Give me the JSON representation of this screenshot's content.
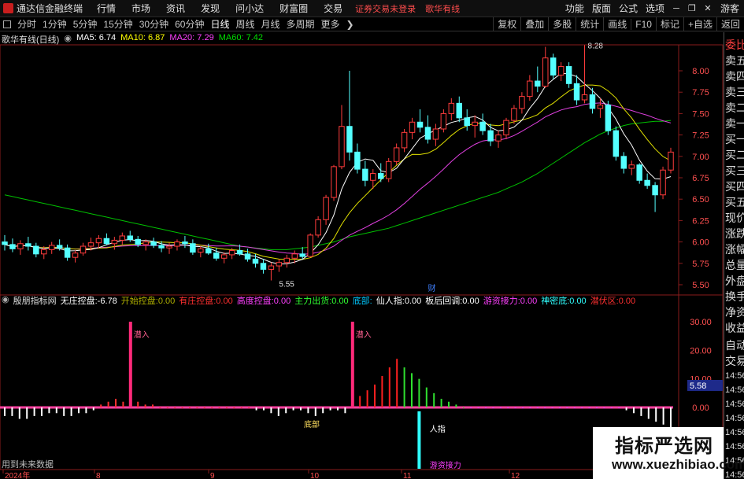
{
  "menubar": {
    "app_title": "通达信金融终端",
    "menus": [
      "行情",
      "市场",
      "资讯",
      "发现",
      "问小达",
      "财富圈",
      "交易"
    ],
    "notice": "证券交易未登录",
    "stock_name": "歌华有线",
    "right_menus": [
      "功能",
      "版面",
      "公式",
      "选项"
    ],
    "guest": "游客"
  },
  "toolbar": {
    "periods": [
      "分时",
      "1分钟",
      "5分钟",
      "15分钟",
      "30分钟",
      "60分钟",
      "日线",
      "周线",
      "月线",
      "多周期",
      "更多"
    ],
    "active": "日线",
    "right_tools": [
      "复权",
      "叠加",
      "多股",
      "统计",
      "画线",
      "F10",
      "标记",
      "+自选",
      "返回"
    ]
  },
  "main_chart": {
    "title": "歌华有线(日线)",
    "ma_values": [
      {
        "label": "MA5",
        "value": "6.74",
        "color": "#ffffff"
      },
      {
        "label": "MA10",
        "value": "6.87",
        "color": "#ffff00"
      },
      {
        "label": "MA20",
        "value": "7.29",
        "color": "#ff40ff"
      },
      {
        "label": "MA60",
        "value": "7.42",
        "color": "#00e000"
      }
    ],
    "price_axis": [
      "8.00",
      "7.75",
      "7.50",
      "7.25",
      "7.00",
      "6.75",
      "6.50",
      "6.25",
      "6.00",
      "5.75",
      "5.50"
    ],
    "high_label": "8.28",
    "low_label": "5.55",
    "event_label": "财"
  },
  "indicator": {
    "name": "殷朋指标网",
    "fields": [
      {
        "label": "无庄控盘:",
        "value": "-6.78",
        "color": "#ffffff"
      },
      {
        "label": "开始控盘:",
        "value": "0.00",
        "color": "#b0b000"
      },
      {
        "label": "有庄控盘:",
        "value": "0.00",
        "color": "#ff3030"
      },
      {
        "label": "高度控盘:",
        "value": "0.00",
        "color": "#ff40ff"
      },
      {
        "label": "主力出货:",
        "value": "0.00",
        "color": "#30ff30"
      },
      {
        "label": "底部:",
        "value": "",
        "color": "#00c8ff"
      },
      {
        "label": "仙人指:",
        "value": "0.00",
        "color": "#ffffff"
      },
      {
        "label": "板后回调:",
        "value": "0.00",
        "color": "#ffffff"
      },
      {
        "label": "游资接力:",
        "value": "0.00",
        "color": "#ff40ff"
      },
      {
        "label": "神密底:",
        "value": "0.00",
        "color": "#30ffff"
      },
      {
        "label": "潜伏区:",
        "value": "0.00",
        "color": "#ff3030"
      }
    ],
    "axis": [
      "30.00",
      "20.00",
      "10.00",
      "0.00"
    ],
    "current_value": "5.58",
    "annotations": {
      "qianru": "潜入",
      "dibu": "底部",
      "renzhi": "人指",
      "youzi": "游资接力"
    }
  },
  "date_axis": [
    "2024年",
    "8",
    "9",
    "10",
    "11",
    "12"
  ],
  "side_panel": {
    "items": [
      "委比",
      "卖五",
      "卖四",
      "卖三",
      "卖二",
      "卖一",
      "买一",
      "买二",
      "买三",
      "买四",
      "买五",
      "现价",
      "涨跌",
      "涨幅",
      "总量",
      "外盘",
      "换手",
      "净资",
      "收益",
      "自动",
      "交易"
    ],
    "times": [
      "14:56",
      "14:56",
      "14:56",
      "14:56",
      "14:56",
      "14:56",
      "14:56",
      "14:56"
    ]
  },
  "footnote": "用到未来数据",
  "watermark": {
    "title": "指标严选网",
    "url": "www.xuezhibiao.com"
  },
  "chart_data": {
    "type": "candlestick",
    "candles": [
      [
        6.0,
        6.08,
        5.9,
        5.97
      ],
      [
        5.97,
        6.04,
        5.88,
        5.92
      ],
      [
        5.92,
        6.02,
        5.85,
        5.98
      ],
      [
        5.98,
        6.06,
        5.9,
        5.95
      ],
      [
        5.95,
        5.99,
        5.82,
        5.86
      ],
      [
        5.86,
        5.95,
        5.8,
        5.91
      ],
      [
        5.91,
        6.0,
        5.86,
        5.96
      ],
      [
        5.96,
        6.03,
        5.9,
        5.93
      ],
      [
        5.93,
        5.97,
        5.78,
        5.82
      ],
      [
        5.82,
        5.9,
        5.76,
        5.87
      ],
      [
        5.87,
        5.99,
        5.84,
        5.95
      ],
      [
        5.95,
        6.05,
        5.9,
        5.99
      ],
      [
        5.99,
        6.08,
        5.93,
        6.04
      ],
      [
        6.04,
        6.1,
        5.96,
        5.98
      ],
      [
        5.98,
        6.06,
        5.91,
        6.02
      ],
      [
        6.02,
        6.11,
        5.97,
        6.07
      ],
      [
        6.07,
        6.13,
        6.0,
        6.03
      ],
      [
        6.03,
        6.07,
        5.94,
        5.97
      ],
      [
        5.97,
        6.03,
        5.9,
        6.0
      ],
      [
        6.0,
        6.05,
        5.93,
        5.96
      ],
      [
        5.96,
        6.01,
        5.88,
        5.93
      ],
      [
        5.93,
        5.99,
        5.86,
        5.95
      ],
      [
        5.95,
        6.03,
        5.9,
        6.0
      ],
      [
        6.0,
        6.07,
        5.93,
        5.98
      ],
      [
        5.98,
        6.03,
        5.85,
        5.88
      ],
      [
        5.88,
        5.95,
        5.82,
        5.92
      ],
      [
        5.92,
        5.98,
        5.85,
        5.87
      ],
      [
        5.87,
        5.93,
        5.78,
        5.81
      ],
      [
        5.81,
        5.88,
        5.75,
        5.85
      ],
      [
        5.85,
        5.93,
        5.8,
        5.9
      ],
      [
        5.9,
        5.97,
        5.84,
        5.86
      ],
      [
        5.86,
        5.92,
        5.77,
        5.8
      ],
      [
        5.8,
        5.86,
        5.7,
        5.75
      ],
      [
        5.75,
        5.8,
        5.63,
        5.68
      ],
      [
        5.68,
        5.76,
        5.55,
        5.72
      ],
      [
        5.72,
        5.8,
        5.65,
        5.76
      ],
      [
        5.76,
        5.85,
        5.7,
        5.81
      ],
      [
        5.81,
        5.9,
        5.75,
        5.86
      ],
      [
        5.86,
        5.94,
        5.8,
        5.83
      ],
      [
        5.83,
        6.1,
        5.82,
        6.08
      ],
      [
        6.08,
        6.3,
        6.05,
        6.26
      ],
      [
        6.26,
        6.55,
        6.2,
        6.52
      ],
      [
        6.52,
        6.9,
        6.48,
        6.88
      ],
      [
        6.88,
        7.6,
        6.85,
        7.35
      ],
      [
        7.35,
        8.0,
        6.95,
        7.05
      ],
      [
        7.05,
        7.15,
        6.8,
        6.85
      ],
      [
        6.85,
        6.95,
        6.65,
        6.72
      ],
      [
        6.72,
        6.85,
        6.62,
        6.8
      ],
      [
        6.8,
        6.92,
        6.7,
        6.74
      ],
      [
        6.74,
        6.98,
        6.7,
        6.94
      ],
      [
        6.94,
        7.15,
        6.9,
        7.1
      ],
      [
        7.1,
        7.32,
        7.05,
        7.28
      ],
      [
        7.28,
        7.45,
        7.2,
        7.4
      ],
      [
        7.4,
        7.55,
        7.28,
        7.34
      ],
      [
        7.34,
        7.48,
        7.15,
        7.2
      ],
      [
        7.2,
        7.38,
        7.12,
        7.32
      ],
      [
        7.32,
        7.55,
        7.28,
        7.5
      ],
      [
        7.5,
        7.68,
        7.42,
        7.62
      ],
      [
        7.62,
        7.7,
        7.4,
        7.45
      ],
      [
        7.45,
        7.55,
        7.3,
        7.36
      ],
      [
        7.36,
        7.48,
        7.22,
        7.4
      ],
      [
        7.4,
        7.5,
        7.25,
        7.3
      ],
      [
        7.3,
        7.38,
        7.12,
        7.18
      ],
      [
        7.18,
        7.3,
        7.1,
        7.25
      ],
      [
        7.25,
        7.45,
        7.2,
        7.42
      ],
      [
        7.42,
        7.6,
        7.38,
        7.56
      ],
      [
        7.56,
        7.75,
        7.5,
        7.7
      ],
      [
        7.7,
        7.95,
        7.65,
        7.88
      ],
      [
        7.88,
        8.05,
        7.75,
        7.82
      ],
      [
        7.82,
        8.28,
        7.8,
        8.15
      ],
      [
        8.15,
        8.2,
        7.9,
        7.95
      ],
      [
        7.95,
        8.1,
        7.88,
        8.05
      ],
      [
        8.05,
        8.1,
        7.8,
        7.85
      ],
      [
        7.85,
        7.95,
        7.6,
        7.66
      ],
      [
        7.66,
        8.3,
        7.62,
        7.72
      ],
      [
        7.72,
        7.8,
        7.5,
        7.56
      ],
      [
        7.56,
        7.68,
        7.45,
        7.6
      ],
      [
        7.6,
        7.65,
        7.25,
        7.3
      ],
      [
        7.3,
        7.35,
        6.95,
        7.0
      ],
      [
        7.0,
        7.05,
        6.8,
        6.86
      ],
      [
        6.86,
        6.95,
        6.78,
        6.9
      ],
      [
        6.9,
        6.92,
        6.68,
        6.72
      ],
      [
        6.72,
        6.8,
        6.62,
        6.66
      ],
      [
        6.66,
        6.7,
        6.35,
        6.55
      ],
      [
        6.55,
        6.88,
        6.5,
        6.84
      ],
      [
        6.84,
        7.1,
        6.8,
        7.05
      ]
    ],
    "ma60": [
      6.55,
      6.53,
      6.51,
      6.49,
      6.47,
      6.45,
      6.43,
      6.41,
      6.39,
      6.37,
      6.35,
      6.33,
      6.31,
      6.29,
      6.27,
      6.25,
      6.23,
      6.21,
      6.19,
      6.17,
      6.15,
      6.13,
      6.11,
      6.09,
      6.07,
      6.05,
      6.03,
      6.01,
      5.99,
      5.97,
      5.95,
      5.94,
      5.93,
      5.92,
      5.91,
      5.91,
      5.91,
      5.92,
      5.93,
      5.94,
      5.96,
      5.98,
      6.0,
      6.03,
      6.06,
      6.08,
      6.1,
      6.12,
      6.14,
      6.16,
      6.19,
      6.22,
      6.25,
      6.28,
      6.31,
      6.34,
      6.37,
      6.4,
      6.43,
      6.46,
      6.49,
      6.52,
      6.55,
      6.58,
      6.62,
      6.66,
      6.7,
      6.75,
      6.8,
      6.86,
      6.92,
      6.98,
      7.04,
      7.1,
      7.16,
      7.21,
      7.26,
      7.3,
      7.33,
      7.36,
      7.38,
      7.39,
      7.4,
      7.41,
      7.41,
      7.42
    ],
    "indicator_bars": [
      -3,
      -3,
      -4,
      -4,
      -3,
      -3,
      -2,
      -2,
      -3,
      -3,
      -2,
      -2,
      -1,
      1,
      2,
      3,
      2,
      30,
      2,
      1,
      1,
      0,
      0,
      0,
      0,
      0,
      0,
      0,
      0,
      0,
      0,
      0,
      0,
      0,
      -1,
      -1,
      -2,
      -3,
      -2,
      -1,
      -1,
      -2,
      -3,
      -2,
      -1,
      -1,
      -2,
      30,
      4,
      6,
      8,
      11,
      14,
      17,
      14,
      12,
      10,
      7,
      5,
      3,
      2,
      1,
      0,
      0,
      0,
      0,
      0,
      0,
      0,
      0,
      0,
      0,
      0,
      0,
      0,
      0,
      0,
      0,
      0,
      0,
      0,
      0,
      0,
      0,
      -1,
      -2,
      -3,
      -4,
      -5,
      -6,
      -7
    ],
    "indicator_colors_note": "red=有庄控盘 green=主力出货 magenta=高度控盘 white=无庄控盘"
  }
}
